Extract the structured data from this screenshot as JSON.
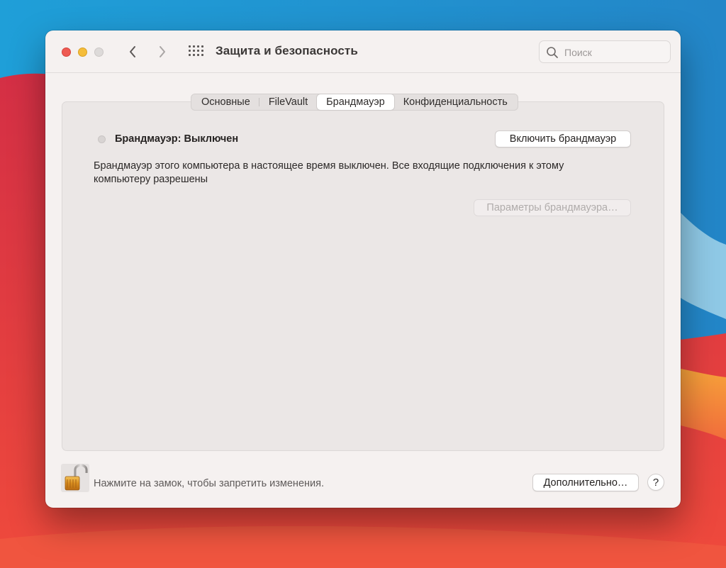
{
  "window": {
    "title": "Защита и безопасность"
  },
  "toolbar": {
    "back_icon": "chevron-left-icon",
    "forward_icon": "chevron-right-icon",
    "show_all_icon": "grid-icon"
  },
  "search": {
    "placeholder": "Поиск",
    "icon": "search-icon"
  },
  "tabs": [
    {
      "label": "Основные",
      "active": false
    },
    {
      "label": "FileVault",
      "active": false
    },
    {
      "label": "Брандмауэр",
      "active": true
    },
    {
      "label": "Конфиденциальность",
      "active": false
    }
  ],
  "firewall": {
    "status_label": "Брандмауэр: Выключен",
    "enable_button": "Включить брандмауэр",
    "description": "Брандмауэр этого компьютера в настоящее время выключен. Все входящие подключения к этому компьютеру разрешены",
    "options_button": "Параметры брандмауэра…"
  },
  "footer": {
    "lock_icon": "unlocked-padlock-icon",
    "lock_text": "Нажмите на замок, чтобы запретить изменения.",
    "advanced_button": "Дополнительно…",
    "help_label": "?"
  },
  "colors": {
    "close": "#ee5a52",
    "minimize": "#f5bd3a",
    "zoom_disabled": "#dddad9",
    "window_bg": "#f5f1f0"
  }
}
